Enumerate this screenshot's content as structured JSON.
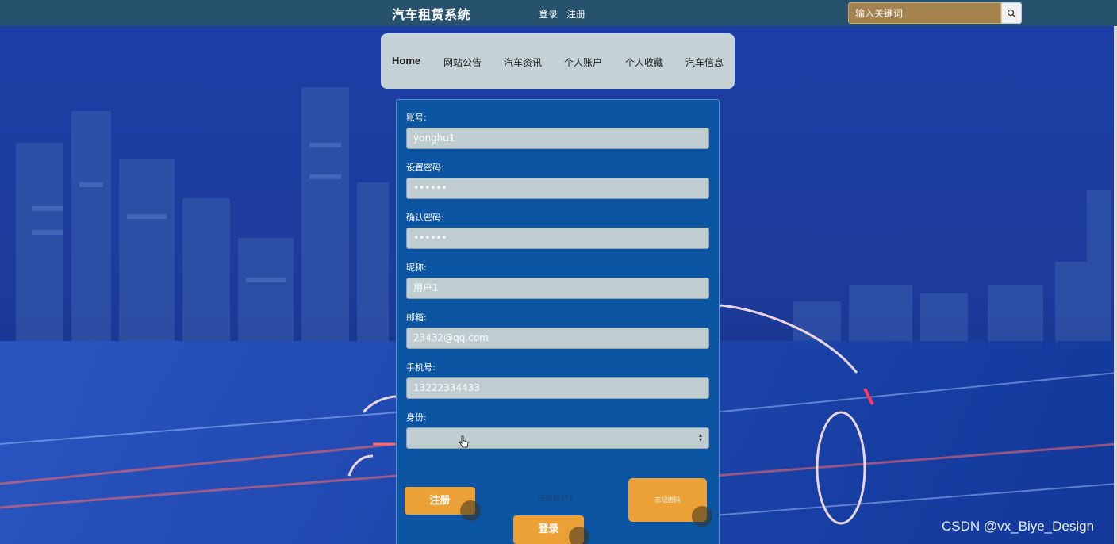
{
  "topbar": {
    "site_title": "汽车租赁系统",
    "login_link": "登录",
    "register_link": "注册",
    "search_placeholder": "输入关键词",
    "search_icon": "search-icon"
  },
  "nav": {
    "items": [
      {
        "label": "Home"
      },
      {
        "label": "网站公告"
      },
      {
        "label": "汽车资讯"
      },
      {
        "label": "个人账户"
      },
      {
        "label": "个人收藏"
      },
      {
        "label": "汽车信息"
      }
    ]
  },
  "form": {
    "fields": [
      {
        "label": "账号:",
        "value": "yonghu1"
      },
      {
        "label": "设置密码:",
        "value": "••••••"
      },
      {
        "label": "确认密码:",
        "value": "••••••"
      },
      {
        "label": "昵称:",
        "value": "用户1"
      },
      {
        "label": "邮箱:",
        "value": "23432@qq.com"
      },
      {
        "label": "手机号:",
        "value": "13222334433"
      }
    ],
    "identity_label": "身份:",
    "identity_value": "",
    "register_button": "注册",
    "login_button": "登录",
    "forgot_button": "忘记密码",
    "has_account_text": "已有账户?"
  },
  "watermark": "CSDN @vx_Biye_Design",
  "colors": {
    "topbar": "#27526e",
    "panel": "#0b55a3",
    "button_accent": "#eca136",
    "search_bg": "#a4834e"
  }
}
